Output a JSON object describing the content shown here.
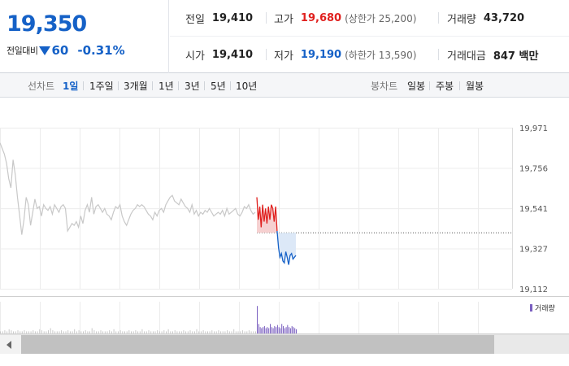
{
  "quote": {
    "price": "19,350",
    "change_label": "전일대비",
    "change_value": "60",
    "change_rate": "-0.31%",
    "prev_close_label": "전일",
    "prev_close": "19,410",
    "high_label": "고가",
    "high": "19,680",
    "upper_limit": "(상한가 25,200)",
    "volume_label": "거래량",
    "volume": "43,720",
    "open_label": "시가",
    "open": "19,410",
    "low_label": "저가",
    "low": "19,190",
    "lower_limit": "(하한가 13,590)",
    "amount_label": "거래대금",
    "amount": "847 백만",
    "colors": {
      "up": "#e0201e",
      "down": "#1561c7"
    }
  },
  "toolbar": {
    "line_label": "선차트",
    "line_periods": [
      "1일",
      "1주일",
      "3개월",
      "1년",
      "3년",
      "5년",
      "10년"
    ],
    "active_period": "1일",
    "candle_label": "봉차트",
    "candle_periods": [
      "일봉",
      "주봉",
      "월봉"
    ]
  },
  "chart_data": {
    "type": "line",
    "yticks": [
      "19,971",
      "19,756",
      "19,541",
      "19,327",
      "19,112"
    ],
    "ylim": [
      19112,
      19971
    ],
    "reference_price": 19410,
    "volume_legend": "거래량",
    "series": [
      {
        "role": "previous_period",
        "color": "#c8c8c8",
        "values": [
          19890,
          19860,
          19830,
          19780,
          19700,
          19650,
          19800,
          19720,
          19600,
          19500,
          19400,
          19480,
          19600,
          19560,
          19450,
          19520,
          19590,
          19540,
          19550,
          19500,
          19560,
          19540,
          19530,
          19550,
          19510,
          19560,
          19540,
          19520,
          19550,
          19560,
          19540,
          19420,
          19440,
          19460,
          19450,
          19470,
          19440,
          19500,
          19460,
          19530,
          19560,
          19520,
          19600,
          19510,
          19550,
          19560,
          19540,
          19520,
          19540,
          19510,
          19500,
          19480,
          19520,
          19550,
          19540,
          19560,
          19500,
          19470,
          19450,
          19480,
          19510,
          19530,
          19540,
          19560,
          19550,
          19560,
          19550,
          19530,
          19510,
          19500,
          19480,
          19520,
          19500,
          19530,
          19540,
          19520,
          19560,
          19580,
          19600,
          19610,
          19580,
          19570,
          19560,
          19590,
          19570,
          19550,
          19540,
          19520,
          19560,
          19510,
          19530,
          19500,
          19520,
          19510,
          19530,
          19520,
          19540,
          19520,
          19500,
          19510,
          19520,
          19510,
          19530,
          19500,
          19540,
          19510,
          19520,
          19530,
          19540,
          19510,
          19500,
          19520,
          19550,
          19540,
          19560,
          19530,
          19510,
          19520
        ]
      },
      {
        "role": "today",
        "color_up": "#e0201e",
        "color_down": "#1561c7",
        "values": [
          19600,
          19480,
          19550,
          19440,
          19560,
          19470,
          19540,
          19460,
          19550,
          19480,
          19560,
          19540,
          19470,
          19550,
          19420,
          19330,
          19280,
          19300,
          19260,
          19250,
          19310,
          19280,
          19240,
          19290,
          19300,
          19270,
          19280,
          19290
        ]
      }
    ],
    "volume": [
      2,
      2,
      3,
      2,
      4,
      3,
      2,
      2,
      3,
      2,
      2,
      3,
      2,
      2,
      2,
      3,
      2,
      2,
      4,
      3,
      2,
      2,
      3,
      5,
      3,
      2,
      2,
      2,
      3,
      2,
      2,
      3,
      2,
      2,
      4,
      2,
      3,
      2,
      2,
      3,
      2,
      2,
      5,
      3,
      2,
      2,
      3,
      2,
      2,
      2,
      3,
      2,
      4,
      2,
      2,
      3,
      2,
      2,
      2,
      3,
      2,
      2,
      3,
      2,
      2,
      4,
      2,
      2,
      3,
      2,
      2,
      2,
      3,
      2,
      2,
      3,
      2,
      4,
      2,
      2,
      3,
      2,
      2,
      2,
      3,
      2,
      2,
      3,
      2,
      2,
      4,
      2,
      2,
      3,
      2,
      2,
      2,
      3,
      2,
      2,
      3,
      2,
      2,
      2,
      3,
      2,
      2,
      4,
      2,
      2,
      2,
      3,
      2,
      2,
      3,
      2,
      2,
      2
    ],
    "volume_today": [
      26,
      9,
      6,
      5,
      6,
      7,
      5,
      6,
      5,
      9,
      6,
      5,
      7,
      6,
      8,
      6,
      5,
      9,
      7,
      5,
      6,
      8,
      6,
      5,
      7,
      6,
      5,
      4
    ]
  }
}
